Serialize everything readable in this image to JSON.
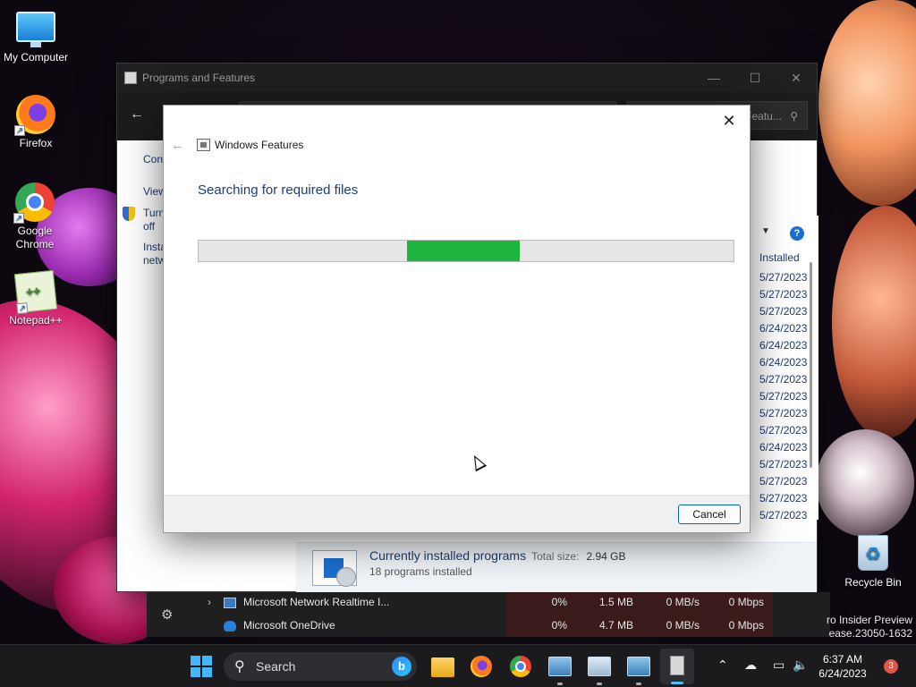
{
  "desktop": {
    "icons": [
      {
        "label": "My Computer"
      },
      {
        "label": "Firefox"
      },
      {
        "label": "Google Chrome"
      },
      {
        "label": "Notepad++"
      },
      {
        "label": "Recycle Bin"
      }
    ],
    "watermark_line1": "ro Insider Preview",
    "watermark_line2": "ease.23050-1632"
  },
  "programs_window": {
    "title": "Programs and Features",
    "search_placeholder": "Search Programs and Featu...",
    "left_links": [
      "Cont",
      "View",
      "Turn",
      "off",
      "Insta",
      "netw"
    ],
    "column_header": "Installed",
    "dates": [
      "5/27/2023",
      "5/27/2023",
      "5/27/2023",
      "6/24/2023",
      "6/24/2023",
      "6/24/2023",
      "5/27/2023",
      "5/27/2023",
      "5/27/2023",
      "5/27/2023",
      "6/24/2023",
      "5/27/2023",
      "5/27/2023",
      "5/27/2023",
      "5/27/2023"
    ],
    "status_main": "Currently installed programs",
    "status_total_label": "Total size:",
    "status_total_value": "2.94 GB",
    "status_count": "18 programs installed"
  },
  "task_manager": {
    "rows": [
      {
        "name": "Microsoft Network Realtime I...",
        "cpu": "0%",
        "memory": "1.5 MB",
        "disk": "0 MB/s",
        "network": "0 Mbps"
      },
      {
        "name": "Microsoft OneDrive",
        "cpu": "0%",
        "memory": "4.7 MB",
        "disk": "0 MB/s",
        "network": "0 Mbps"
      }
    ]
  },
  "dialog": {
    "title": "Windows Features",
    "heading": "Searching for required files",
    "progress_start": 0.39,
    "progress_end": 0.6,
    "progress_color": "#1db540",
    "cancel_label": "Cancel"
  },
  "taskbar": {
    "search_label": "Search",
    "time": "6:37 AM",
    "date": "6/24/2023",
    "notification_count": "3",
    "accent_color": "#4cc2ff"
  }
}
